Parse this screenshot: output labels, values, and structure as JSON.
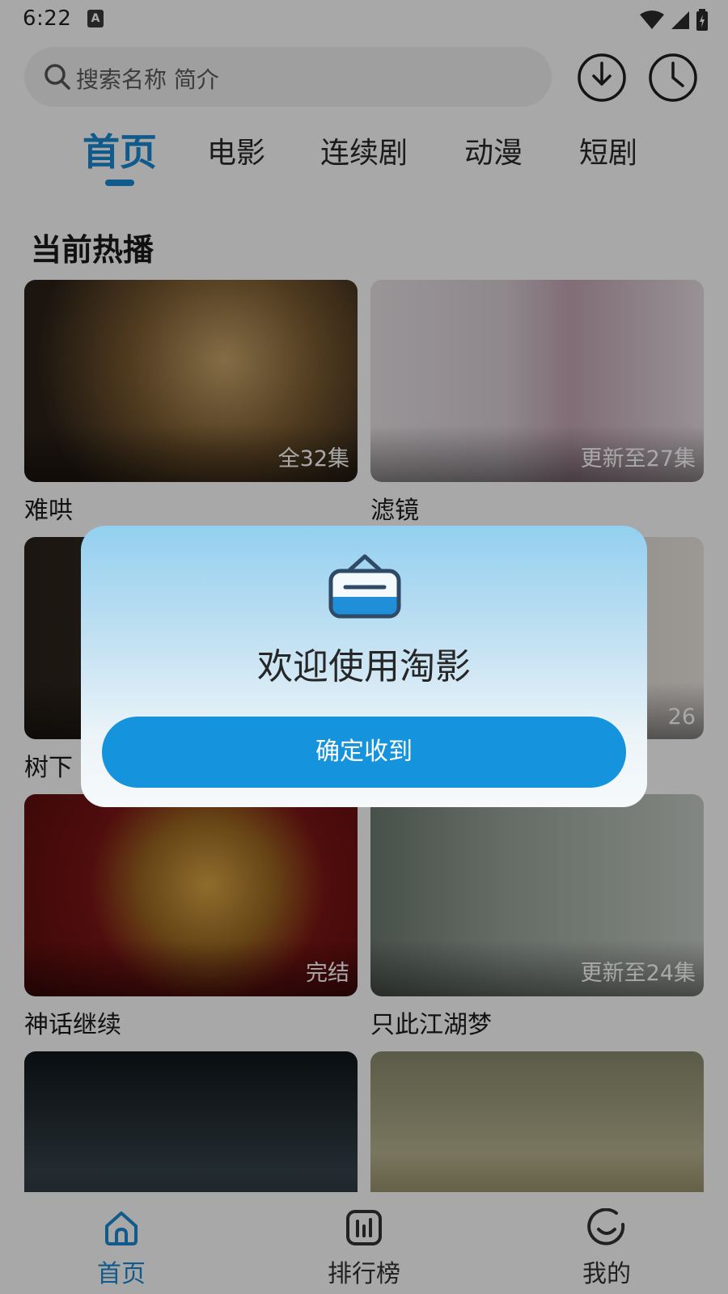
{
  "status_bar": {
    "time": "6:22",
    "notification_icon": "A"
  },
  "search": {
    "placeholder": "搜索名称 简介"
  },
  "header_icons": [
    "download-icon",
    "history-icon"
  ],
  "tabs": [
    {
      "label": "首页",
      "active": true
    },
    {
      "label": "电影"
    },
    {
      "label": "连续剧"
    },
    {
      "label": "动漫"
    },
    {
      "label": "短剧"
    }
  ],
  "section": {
    "title": "当前热播"
  },
  "cards": [
    {
      "title": "难哄",
      "badge": "全32集"
    },
    {
      "title": "滤镜",
      "badge": "更新至27集"
    },
    {
      "title": "树下",
      "badge": ""
    },
    {
      "title": "",
      "badge": "26"
    },
    {
      "title": "神话继续",
      "badge": "完结"
    },
    {
      "title": "只此江湖梦",
      "badge": "更新至24集"
    },
    {
      "title": "",
      "badge": ""
    },
    {
      "title": "",
      "badge": ""
    }
  ],
  "dialog": {
    "title": "欢迎使用淘影",
    "button": "确定收到",
    "icon": "welcome-bag-icon"
  },
  "bottom_nav": [
    {
      "label": "首页",
      "icon": "home-icon",
      "active": true
    },
    {
      "label": "排行榜",
      "icon": "ranking-icon"
    },
    {
      "label": "我的",
      "icon": "profile-icon"
    }
  ],
  "colors": {
    "accent": "#1a8ad5",
    "button": "#1593dc",
    "scrim": "rgba(0,0,0,0.34)"
  }
}
